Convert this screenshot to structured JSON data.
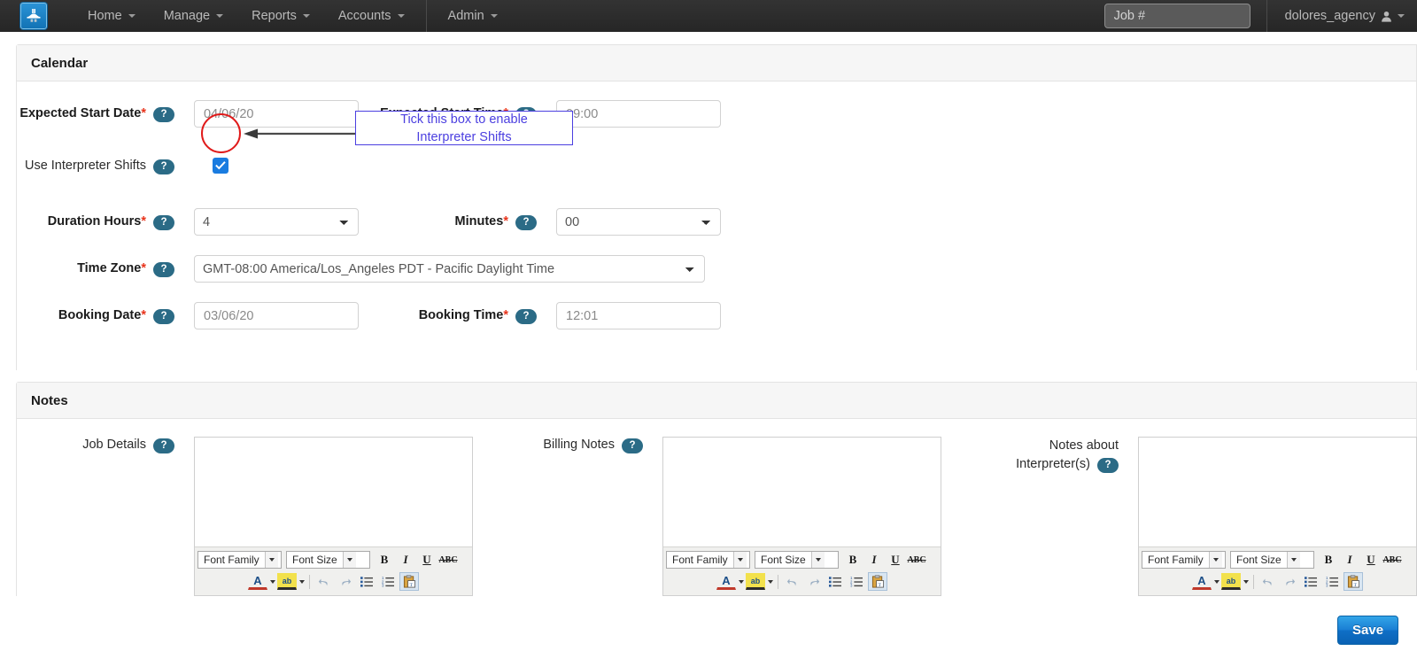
{
  "navbar": {
    "logo_icon": "anvil-logo-icon",
    "items": [
      {
        "label": "Home",
        "icon": "chevron-down-icon"
      },
      {
        "label": "Manage",
        "icon": "chevron-down-icon"
      },
      {
        "label": "Reports",
        "icon": "chevron-down-icon"
      },
      {
        "label": "Accounts",
        "icon": "chevron-down-icon"
      },
      {
        "label": "Admin",
        "icon": "chevron-down-icon"
      }
    ],
    "job_search": {
      "placeholder": "Job #",
      "value": ""
    },
    "user": {
      "name": "dolores_agency",
      "icon": "user-icon",
      "caret": "chevron-down-icon"
    }
  },
  "calendar_panel": {
    "title": "Calendar",
    "fields": {
      "expected_start_date": {
        "label": "Expected Start Date",
        "required": "*",
        "help": "?",
        "value": "04/06/20"
      },
      "expected_start_time": {
        "label": "Expected Start Time",
        "required": "*",
        "help": "?",
        "value": "09:00"
      },
      "use_interpreter_shifts": {
        "label": "Use Interpreter Shifts",
        "help": "?",
        "checked": true
      },
      "duration_hours": {
        "label": "Duration Hours",
        "required": "*",
        "help": "?",
        "value": "4"
      },
      "minutes": {
        "label": "Minutes",
        "required": "*",
        "help": "?",
        "value": "00"
      },
      "time_zone": {
        "label": "Time Zone",
        "required": "*",
        "help": "?",
        "value": "GMT-08:00 America/Los_Angeles PDT - Pacific Daylight Time"
      },
      "booking_date": {
        "label": "Booking Date",
        "required": "*",
        "help": "?",
        "value": "03/06/20"
      },
      "booking_time": {
        "label": "Booking Time",
        "required": "*",
        "help": "?",
        "value": "12:01"
      }
    }
  },
  "annotation": {
    "text": "Tick this box to enable\nInterpreter Shifts",
    "circle_color": "#e01b1b",
    "box_color": "#4b3fe0"
  },
  "notes_panel": {
    "title": "Notes",
    "editors": [
      {
        "label": "Job Details",
        "help": "?",
        "content": ""
      },
      {
        "label": "Billing Notes",
        "help": "?",
        "content": ""
      },
      {
        "label": "Notes about Interpreter(s)",
        "help": "?",
        "content": ""
      }
    ],
    "toolbar": {
      "font_family": "Font Family",
      "font_size": "Font Size",
      "bold": "B",
      "italic": "I",
      "underline": "U",
      "strikethrough": "ABC",
      "font_color": "A",
      "highlight": "ab",
      "undo": "undo-icon",
      "redo": "redo-icon",
      "bullet_list": "bullet-list-icon",
      "numbered_list": "numbered-list-icon",
      "paste_text": "paste-as-text-icon"
    }
  },
  "footer": {
    "save_label": "Save"
  },
  "colors": {
    "accent": "#1a7fd4",
    "help_badge": "#2b6b86",
    "required": "#e8341c",
    "navbar": "#2b2b2b"
  }
}
